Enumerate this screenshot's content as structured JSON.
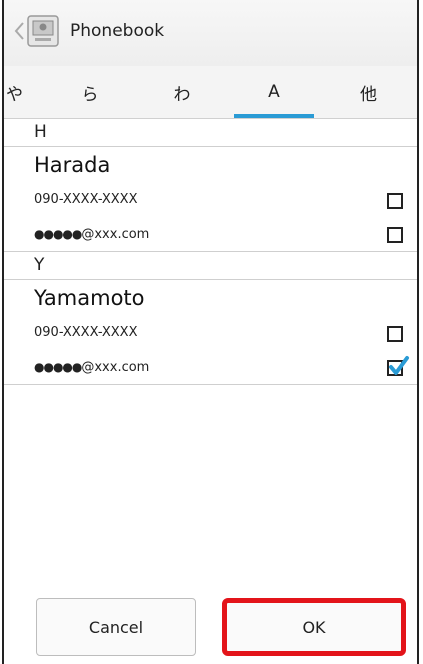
{
  "header": {
    "title": "Phonebook",
    "back_icon": "chevron-left-icon",
    "app_icon": "phonebook-icon"
  },
  "tabs": [
    {
      "label": "や",
      "active": false
    },
    {
      "label": "ら",
      "active": false
    },
    {
      "label": "わ",
      "active": false
    },
    {
      "label": "A",
      "active": true
    },
    {
      "label": "他",
      "active": false
    }
  ],
  "sections": [
    {
      "letter": "H",
      "contact": "Harada",
      "entries": [
        {
          "dots": "●●●●●",
          "value": "090-XXXX-XXXX",
          "checked": false
        },
        {
          "dots": "●●●●●",
          "value": "@xxx.com",
          "checked": false
        }
      ]
    },
    {
      "letter": "Y",
      "contact": "Yamamoto",
      "entries": [
        {
          "dots": "",
          "value": "090-XXXX-XXXX",
          "checked": false
        },
        {
          "dots": "●●●●●",
          "value": "@xxx.com",
          "checked": true
        }
      ]
    }
  ],
  "buttons": {
    "cancel": "Cancel",
    "ok": "OK"
  },
  "colors": {
    "tab_indicator": "#2a9bd5",
    "highlight": "#e3141a",
    "checkmark": "#2a9bd5"
  }
}
